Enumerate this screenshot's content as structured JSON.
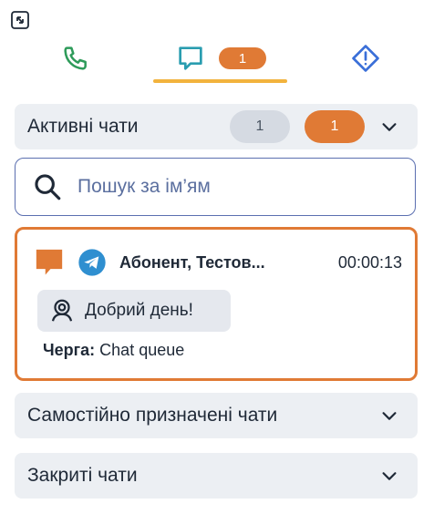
{
  "tabs": {
    "chat_badge": "1"
  },
  "active_chats": {
    "title": "Активні чати",
    "count_grey": "1",
    "count_orange": "1"
  },
  "search": {
    "placeholder": "Пошук за ім’ям"
  },
  "chat_item": {
    "contact": "Абонент, Тестов...",
    "timer": "00:00:13",
    "last_message": "Добрий день!",
    "queue_label": "Черга:",
    "queue_value": "Chat queue"
  },
  "self_assigned": {
    "title": "Самостійно призначені чати"
  },
  "closed_chats": {
    "title": "Закриті чати"
  },
  "colors": {
    "accent": "#e07a35",
    "tab_underline": "#f2b33d",
    "phone_icon": "#2e9b5a",
    "chat_icon": "#2a9db0",
    "alert_icon": "#3a6fd8",
    "telegram": "#2f8fd0"
  },
  "icons": [
    "collapse-icon",
    "phone-icon",
    "chat-icon",
    "alert-diamond-icon",
    "chevron-down-icon",
    "search-icon",
    "message-icon",
    "telegram-icon",
    "bot-icon"
  ]
}
